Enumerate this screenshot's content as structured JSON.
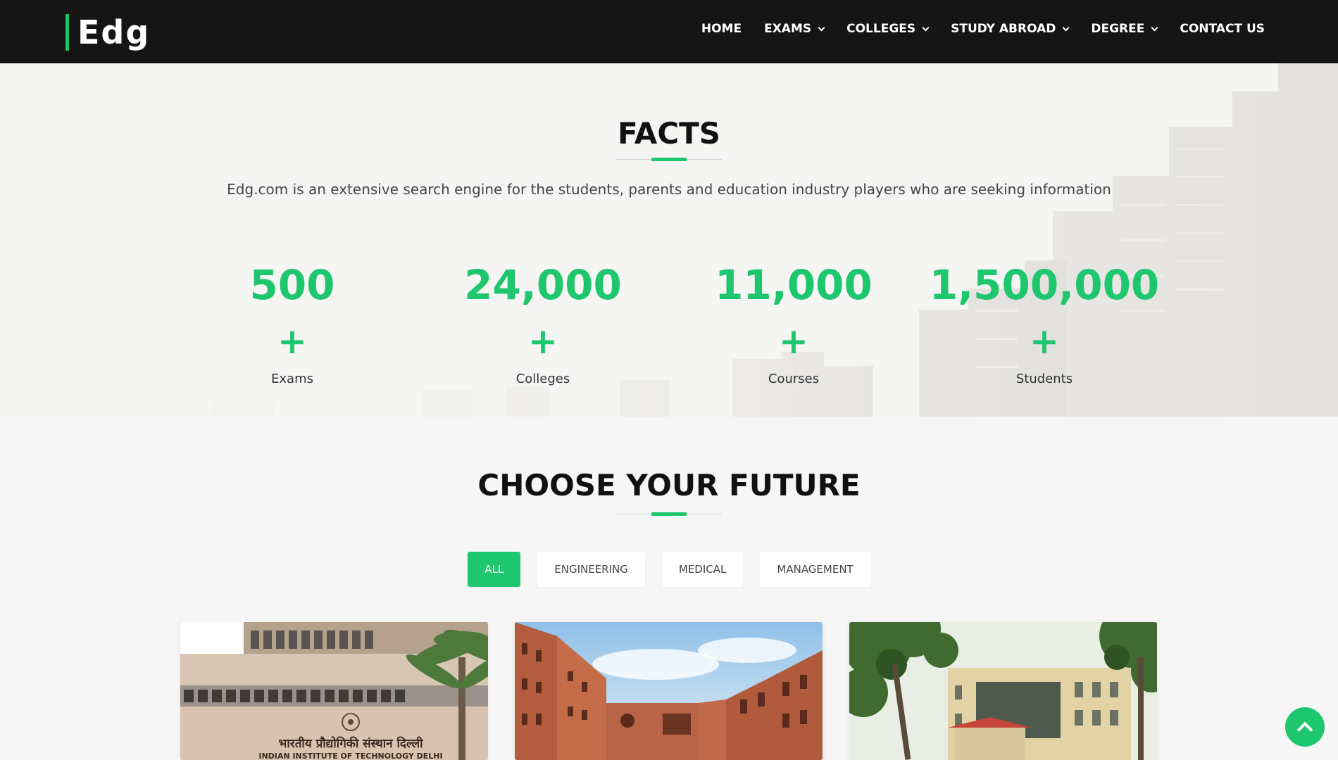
{
  "brand": {
    "name": "Edg",
    "accent_color": "#1ec66d"
  },
  "nav": {
    "items": [
      {
        "label": "HOME",
        "dropdown": false
      },
      {
        "label": "EXAMS",
        "dropdown": true
      },
      {
        "label": "COLLEGES",
        "dropdown": true
      },
      {
        "label": "STUDY ABROAD",
        "dropdown": true
      },
      {
        "label": "DEGREE",
        "dropdown": true
      },
      {
        "label": "CONTACT US",
        "dropdown": false
      }
    ]
  },
  "facts": {
    "title": "FACTS",
    "description": "Edg.com is an extensive search engine for the students, parents and education industry players who are seeking information",
    "stats": [
      {
        "value": "500",
        "suffix": "+",
        "label": "Exams"
      },
      {
        "value": "24,000",
        "suffix": "+",
        "label": "Colleges"
      },
      {
        "value": "11,000",
        "suffix": "+",
        "label": "Courses"
      },
      {
        "value": "1,500,000",
        "suffix": "+",
        "label": "Students"
      }
    ]
  },
  "future": {
    "title": "CHOOSE YOUR FUTURE",
    "filters": [
      "ALL",
      "ENGINEERING",
      "MEDICAL",
      "MANAGEMENT"
    ],
    "active_filter": "ALL",
    "cards": [
      {
        "sign_hindi": "भारतीय प्रौद्योगिकी संस्थान दिल्ली",
        "sign_english": "INDIAN INSTITUTE OF TECHNOLOGY DELHI"
      },
      {},
      {}
    ]
  },
  "icons": {
    "scroll_top": "chevron-up-icon",
    "dropdown": "chevron-down-icon"
  }
}
